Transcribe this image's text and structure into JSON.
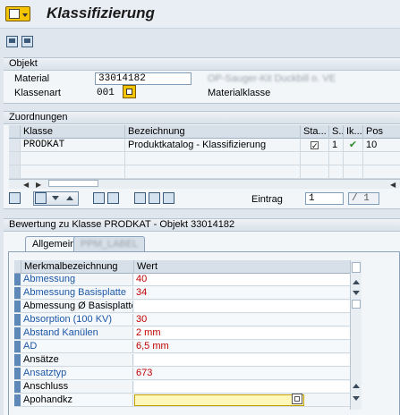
{
  "window": {
    "title": "Klassifizierung"
  },
  "objekt": {
    "section_title": "Objekt",
    "material_label": "Material",
    "material_value": "33014182",
    "material_desc": "OP-Sauger-Kit Duckbill o. VE",
    "klassenart_label": "Klassenart",
    "klassenart_value": "001",
    "klassenart_desc": "Materialklasse"
  },
  "zuordnungen": {
    "section_title": "Zuordnungen",
    "columns": [
      "Klasse",
      "Bezeichnung",
      "Sta...",
      "S...",
      "Ik...",
      "Pos"
    ],
    "rows": [
      {
        "klasse": "PRODKAT",
        "bezeichnung": "Produktkatalog - Klassifizierung",
        "status": "1",
        "pos": "10"
      }
    ],
    "eintrag_label": "Eintrag",
    "eintrag_value": "1",
    "eintrag_total": "/ 1"
  },
  "bewertung": {
    "section_title": "Bewertung zu Klasse PRODKAT - Objekt 33014182",
    "tabs": [
      "Allgemein",
      "PPM_LABEL"
    ],
    "columns": [
      "Merkmalbezeichnung",
      "Wert"
    ],
    "rows": [
      {
        "name": "Abmessung",
        "value": "40"
      },
      {
        "name": "Abmessung Basisplatte",
        "value": "34"
      },
      {
        "name": "Abmessung Ø Basisplatte ..",
        "value": ""
      },
      {
        "name": "Absorption (100 KV)",
        "value": "30"
      },
      {
        "name": "Abstand Kanülen",
        "value": "2 mm"
      },
      {
        "name": "AD",
        "value": "6,5 mm"
      },
      {
        "name": "Ansätze",
        "value": ""
      },
      {
        "name": "Ansatztyp",
        "value": "673"
      },
      {
        "name": "Anschluss",
        "value": ""
      },
      {
        "name": "Apohandkz",
        "value": ""
      }
    ]
  },
  "colors": {
    "accent": "#5e88b8",
    "value_red": "#c00000",
    "link_blue": "#1c57a6"
  },
  "icons": [
    "app-menu-icon",
    "back-icon",
    "save-icon",
    "class-search-icon",
    "checkmark-icon",
    "f4-help-icon"
  ]
}
